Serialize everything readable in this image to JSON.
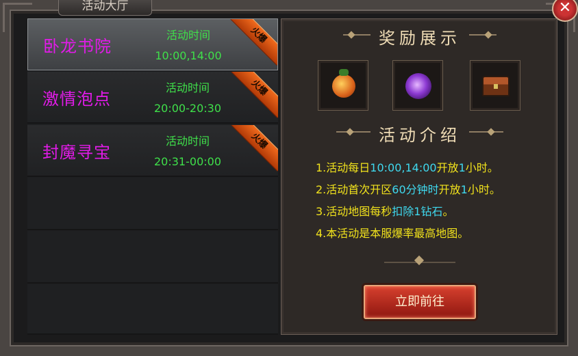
{
  "window": {
    "title": "活动大厅",
    "close_icon": "close-icon"
  },
  "activities": [
    {
      "name": "卧龙书院",
      "time_label": "活动时间",
      "time": "10:00,14:00",
      "badge": "火爆",
      "selected": true
    },
    {
      "name": "激情泡点",
      "time_label": "活动时间",
      "time": "20:00-20:30",
      "badge": "火爆",
      "selected": false
    },
    {
      "name": "封魔寻宝",
      "time_label": "活动时间",
      "time": "20:31-00:00",
      "badge": "火爆",
      "selected": false
    }
  ],
  "rewards": {
    "title": "奖励展示",
    "items": [
      "lucky-bag-icon",
      "purple-rose-icon",
      "treasure-chest-icon"
    ]
  },
  "intro": {
    "title": "活动介绍",
    "lines": [
      {
        "prefix": "1.活动每日",
        "highlight": "10:00,14:00",
        "mid": "开放",
        "highlight2": "1",
        "suffix": "小时。"
      },
      {
        "prefix": "2.活动首次开区",
        "highlight": "60分钟时",
        "mid": "开放",
        "highlight2": "1",
        "suffix": "小时。"
      },
      {
        "prefix": "3.活动地图每秒",
        "highlight": "扣除1钻石",
        "mid": "",
        "highlight2": "",
        "suffix": "。"
      },
      {
        "prefix": "4.本活动是本服爆率最高地图。",
        "highlight": "",
        "mid": "",
        "highlight2": "",
        "suffix": ""
      }
    ]
  },
  "action": {
    "go_label": "立即前往"
  },
  "colors": {
    "name": "#e11be8",
    "time": "#3fe04a",
    "desc": "#f1e21c",
    "highlight": "#3fd9ef",
    "badge": "#f06a1d"
  }
}
